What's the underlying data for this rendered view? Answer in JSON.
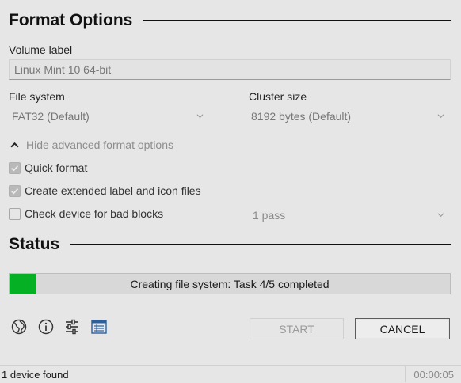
{
  "format_options": {
    "title": "Format Options",
    "volume_label": {
      "label": "Volume label",
      "value": "Linux Mint 10 64-bit"
    },
    "file_system": {
      "label": "File system",
      "value": "FAT32 (Default)"
    },
    "cluster_size": {
      "label": "Cluster size",
      "value": "8192 bytes (Default)"
    },
    "advanced_toggle": "Hide advanced format options",
    "quick_format": {
      "label": "Quick format",
      "checked": true
    },
    "extended_label": {
      "label": "Create extended label and icon files",
      "checked": true
    },
    "bad_blocks": {
      "label": "Check device for bad blocks",
      "checked": false,
      "passes": "1 pass"
    }
  },
  "status": {
    "title": "Status",
    "progress_text": "Creating file system: Task 4/5 completed",
    "progress_fraction": 0.06,
    "accent_color": "#06b025"
  },
  "toolbar": {
    "icons": [
      "globe-icon",
      "info-icon",
      "settings-sliders-icon",
      "log-icon"
    ],
    "start_label": "START",
    "cancel_label": "CANCEL"
  },
  "statusbar": {
    "devices": "1 device found",
    "elapsed": "00:00:05"
  }
}
